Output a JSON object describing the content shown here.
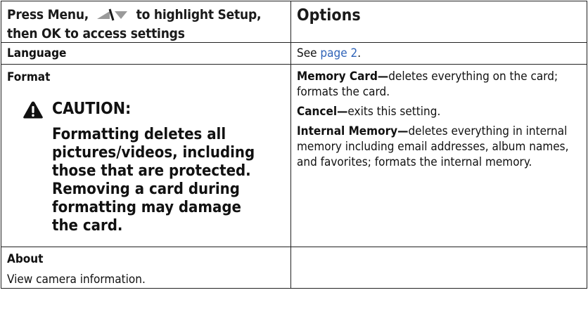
{
  "header": {
    "left_part1": "Press Menu,",
    "left_part2": "to highlight Setup,",
    "left_line2": "then OK to access settings",
    "right": "Options",
    "arrow_icon": "up-down-arrow-icon"
  },
  "rows": {
    "language": {
      "label": "Language",
      "see_prefix": "See ",
      "link_text": "page 2",
      "see_suffix": "."
    },
    "format": {
      "label": "Format",
      "caution_icon": "warning-triangle-icon",
      "caution_title": "CAUTION:",
      "caution_text": "Formatting deletes all pictures/videos, including those that are protected. Removing a card during formatting may damage the card.",
      "options": [
        {
          "name": "Memory Card—",
          "desc": "deletes everything on the card; formats the card."
        },
        {
          "name": "Cancel—",
          "desc": "exits this setting."
        },
        {
          "name": "Internal Memory—",
          "desc": "deletes everything in internal memory including email addresses, album names, and favorites; formats the internal memory."
        }
      ]
    },
    "about": {
      "label": "About",
      "desc": "View camera information."
    }
  },
  "colors": {
    "link": "#2f63b8",
    "border": "#222222"
  }
}
